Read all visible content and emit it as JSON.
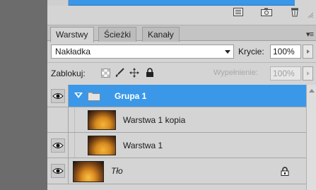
{
  "tabs": [
    {
      "label": "Warstwy",
      "active": true
    },
    {
      "label": "Ścieżki",
      "active": false
    },
    {
      "label": "Kanały",
      "active": false
    }
  ],
  "panel_menu_glyph": "▾≡",
  "blend": {
    "mode": "Nakładka",
    "opacity_label": "Krycie:",
    "opacity_value": "100%"
  },
  "lock": {
    "label": "Zablokuj:",
    "fill_label": "Wypełnienie:",
    "fill_value": "100%"
  },
  "layers": [
    {
      "name": "Grupa 1",
      "type": "group",
      "selected": true,
      "visible": true,
      "expanded": true
    },
    {
      "name": "Warstwa 1 kopia",
      "type": "layer",
      "visible": false,
      "indented": true
    },
    {
      "name": "Warstwa 1",
      "type": "layer",
      "visible": true,
      "indented": true
    },
    {
      "name": "Tło",
      "type": "background",
      "visible": true,
      "locked": true
    }
  ],
  "colors": {
    "selection_blue": "#3b98e8",
    "panel_bg": "#d4d4d4",
    "outer_bg": "#6c6c6c"
  }
}
